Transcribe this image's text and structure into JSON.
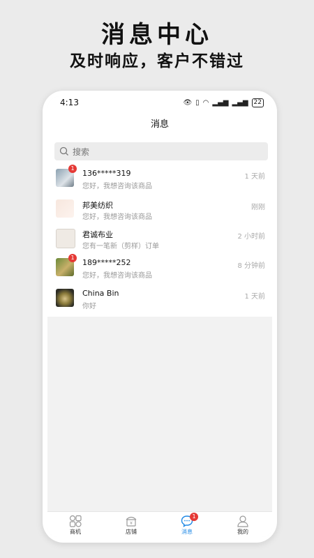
{
  "promo": {
    "title": "消息中心",
    "subtitle": "及时响应，客户不错过"
  },
  "status_bar": {
    "time": "4:13",
    "battery": "22"
  },
  "nav": {
    "title": "消息"
  },
  "search": {
    "placeholder": "搜索"
  },
  "conversations": [
    {
      "name": "136*****319",
      "message": "您好，我想咨询该商品",
      "time": "1 天前",
      "badge": "1"
    },
    {
      "name": "邦美纺织",
      "message": "您好，我想咨询该商品",
      "time": "刚刚",
      "badge": ""
    },
    {
      "name": "君诚布业",
      "message": "您有一笔新（剪样）订单",
      "time": "2 小时前",
      "badge": ""
    },
    {
      "name": "189*****252",
      "message": "您好，我想咨询该商品",
      "time": "8 分钟前",
      "badge": "1"
    },
    {
      "name": "China Bin",
      "message": "你好",
      "time": "1 天前",
      "badge": ""
    }
  ],
  "tabs": [
    {
      "label": "商机",
      "icon": "grid-icon"
    },
    {
      "label": "店铺",
      "icon": "shop-icon"
    },
    {
      "label": "消息",
      "icon": "chat-icon",
      "badge": "1",
      "active": true
    },
    {
      "label": "我的",
      "icon": "user-icon"
    }
  ],
  "colors": {
    "accent": "#1e88e5",
    "badge": "#e53935"
  }
}
